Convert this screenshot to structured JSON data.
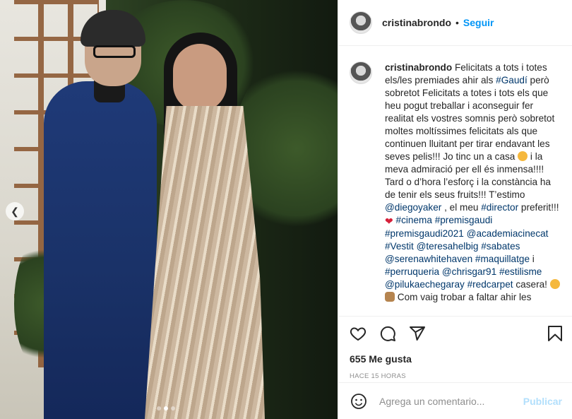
{
  "header": {
    "username": "cristinabrondo",
    "separator": "•",
    "follow_label": "Seguir"
  },
  "caption": {
    "username": "cristinabrondo",
    "segments": [
      {
        "t": "text",
        "v": " Felicitats a tots i totes els/les premiades ahir als "
      },
      {
        "t": "tag",
        "v": "#Gaudí"
      },
      {
        "t": "text",
        "v": " però sobretot Felicitats a totes i tots els que heu pogut treballar i aconseguir fer realitat els vostres somnis però sobretot moltes moltíssimes felicitats als que continuen lluitant per tirar endavant les seves pelis!!! Jo tinc un a casa "
      },
      {
        "t": "emoji",
        "v": "smile"
      },
      {
        "t": "text",
        "v": " i la meva admiració per ell és inmensa!!!! Tard o d’hora l’esforç i la constància ha de tenir els seus fruits!!! T’estimo "
      },
      {
        "t": "tag",
        "v": "@diegoyaker"
      },
      {
        "t": "text",
        "v": " , el meu "
      },
      {
        "t": "tag",
        "v": "#director"
      },
      {
        "t": "text",
        "v": " preferit!!!"
      },
      {
        "t": "emoji",
        "v": "heart"
      },
      {
        "t": "text",
        "v": " "
      },
      {
        "t": "tag",
        "v": "#cinema"
      },
      {
        "t": "text",
        "v": " "
      },
      {
        "t": "tag",
        "v": "#premisgaudi"
      },
      {
        "t": "text",
        "v": " "
      },
      {
        "t": "tag",
        "v": "#premisgaudi2021"
      },
      {
        "t": "text",
        "v": " "
      },
      {
        "t": "tag",
        "v": "@academiacinecat"
      },
      {
        "t": "text",
        "v": " "
      },
      {
        "t": "tag",
        "v": "#Vestit"
      },
      {
        "t": "text",
        "v": " "
      },
      {
        "t": "tag",
        "v": "@teresahelbig"
      },
      {
        "t": "text",
        "v": " "
      },
      {
        "t": "tag",
        "v": "#sabates"
      },
      {
        "t": "text",
        "v": " "
      },
      {
        "t": "tag",
        "v": "@serenawhitehaven"
      },
      {
        "t": "text",
        "v": " "
      },
      {
        "t": "tag",
        "v": "#maquillatge"
      },
      {
        "t": "text",
        "v": " i "
      },
      {
        "t": "tag",
        "v": "#perruqueria"
      },
      {
        "t": "text",
        "v": " "
      },
      {
        "t": "tag",
        "v": "@chrisgar91"
      },
      {
        "t": "text",
        "v": " "
      },
      {
        "t": "tag",
        "v": "#estilisme"
      },
      {
        "t": "text",
        "v": " "
      },
      {
        "t": "tag",
        "v": "@pilukaechegaray"
      },
      {
        "t": "text",
        "v": " "
      },
      {
        "t": "tag",
        "v": "#redcarpet"
      },
      {
        "t": "text",
        "v": " casera! "
      },
      {
        "t": "emoji",
        "v": "smile"
      },
      {
        "t": "text",
        "v": " "
      },
      {
        "t": "emoji",
        "v": "person"
      },
      {
        "t": "text",
        "v": " Com vaig trobar a faltar ahir les"
      }
    ]
  },
  "actions": {
    "likes": "655 Me gusta",
    "time": "HACE 15 HORAS",
    "icons": [
      "heart-icon",
      "comment-icon",
      "share-icon",
      "bookmark-icon"
    ]
  },
  "comment": {
    "placeholder": "Agrega un comentario...",
    "publish_label": "Publicar"
  },
  "carousel": {
    "count": 3,
    "active": 2
  },
  "colors": {
    "link": "#00376b",
    "follow": "#0095f6",
    "publish_disabled": "#b2dffc"
  }
}
